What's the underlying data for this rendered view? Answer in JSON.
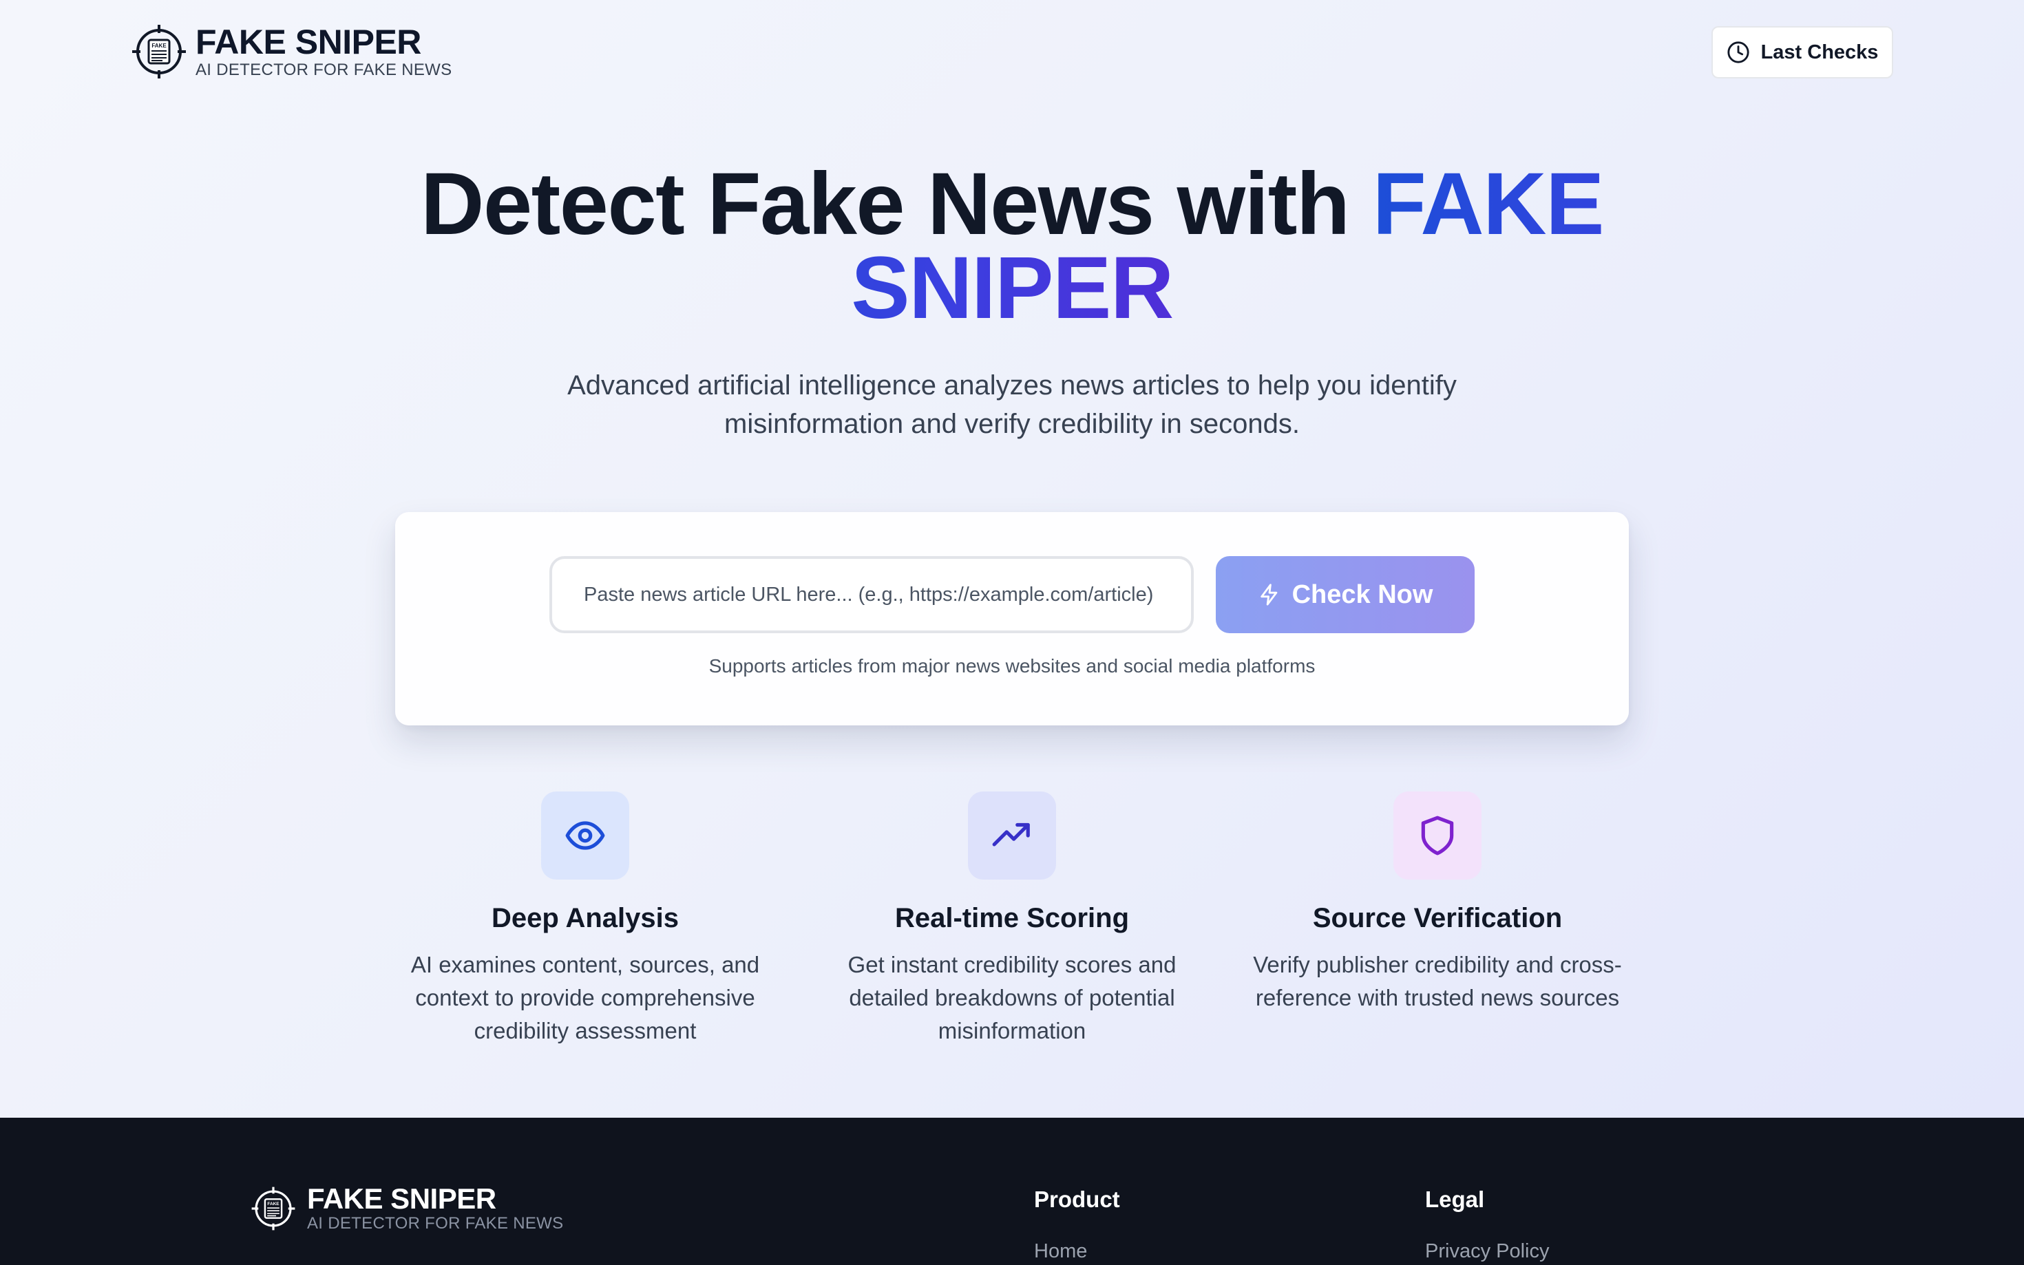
{
  "brand": {
    "title": "FAKE SNIPER",
    "subtitle": "AI DETECTOR FOR FAKE NEWS",
    "logo_icon": "crosshair-newspaper-icon",
    "logo_text": "FAKE"
  },
  "header": {
    "last_checks_label": "Last Checks",
    "last_checks_icon": "clock-icon"
  },
  "hero": {
    "title_main": "Detect Fake News with",
    "title_accent": "FAKE SNIPER",
    "subtitle": "Advanced artificial intelligence analyzes news articles to help you identify misinformation and verify credibility in seconds."
  },
  "search": {
    "placeholder": "Paste news article URL here... (e.g., https://example.com/article)",
    "value": "",
    "button_label": "Check Now",
    "button_icon": "lightning-icon",
    "support_text": "Supports articles from major news websites and social media platforms"
  },
  "features": [
    {
      "icon": "eye-icon",
      "title": "Deep Analysis",
      "description": "AI examines content, sources, and context to provide comprehensive credibility assessment"
    },
    {
      "icon": "trending-up-icon",
      "title": "Real-time Scoring",
      "description": "Get instant credibility scores and detailed breakdowns of potential misinformation"
    },
    {
      "icon": "shield-icon",
      "title": "Source Verification",
      "description": "Verify publisher credibility and cross-reference with trusted news sources"
    }
  ],
  "footer": {
    "brand_title": "FAKE SNIPER",
    "brand_subtitle": "AI DETECTOR FOR FAKE NEWS",
    "columns": [
      {
        "heading": "Product",
        "links": [
          "Home"
        ]
      },
      {
        "heading": "Legal",
        "links": [
          "Privacy Policy"
        ]
      }
    ]
  },
  "colors": {
    "accent_start": "#1d4ed8",
    "accent_end": "#4f2fd8",
    "button_start": "#8ba0f2",
    "button_end": "#9a92ee",
    "footer_bg": "#0f131d"
  }
}
